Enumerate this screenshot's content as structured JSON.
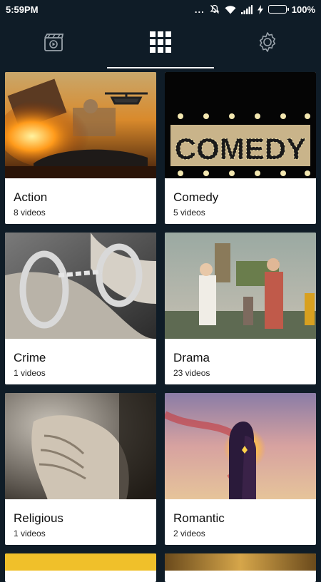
{
  "status": {
    "time": "5:59PM",
    "dots": "...",
    "battery_text": "100%",
    "battery_level": 1.0,
    "battery_color": "#2fd12f"
  },
  "tabs": [
    {
      "icon": "video-icon",
      "active": false
    },
    {
      "icon": "grid-icon",
      "active": true
    },
    {
      "icon": "gear-icon",
      "active": false
    }
  ],
  "categories": [
    {
      "title": "Action",
      "count": "8 videos"
    },
    {
      "title": "Comedy",
      "count": "5 videos"
    },
    {
      "title": "Crime",
      "count": "1 videos"
    },
    {
      "title": "Drama",
      "count": "23 videos"
    },
    {
      "title": "Religious",
      "count": "1 videos"
    },
    {
      "title": "Romantic",
      "count": "2 videos"
    }
  ],
  "colors": {
    "background": "#0f1c27",
    "tab_indicator": "#ffffff",
    "card": "#ffffff"
  }
}
